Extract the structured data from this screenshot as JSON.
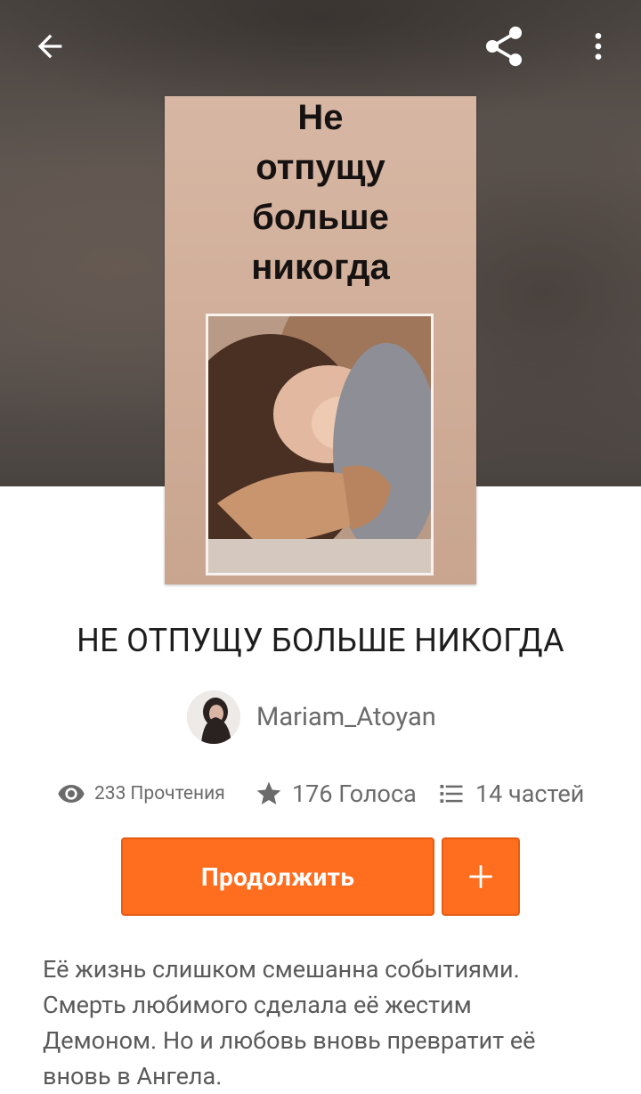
{
  "topbar": {
    "back_icon": "arrow-left-icon",
    "share_icon": "share-icon",
    "more_icon": "more-vertical-icon"
  },
  "cover": {
    "lines": [
      "Не",
      "отпущу",
      "больше",
      "никогда"
    ]
  },
  "story": {
    "title": "НЕ ОТПУЩУ БОЛЬШЕ НИКОГДА",
    "author": "Mariam_Atoyan",
    "stats": {
      "reads_count": "233",
      "reads_label": "Прочтения",
      "votes": "176 Голоса",
      "parts": "14 частей"
    },
    "description_lines": [
      "Её жизнь слишком смешанна событиями.",
      "Смерть любимого сделала её жестим",
      "Демоном. Но и любовь вновь превратит её",
      "вновь в Ангела."
    ]
  },
  "actions": {
    "continue_label": "Продолжить",
    "add_icon": "plus-icon"
  },
  "colors": {
    "accent": "#ff6d1f",
    "accent_border": "#e65c12",
    "hero_bg": "#5a524e"
  }
}
